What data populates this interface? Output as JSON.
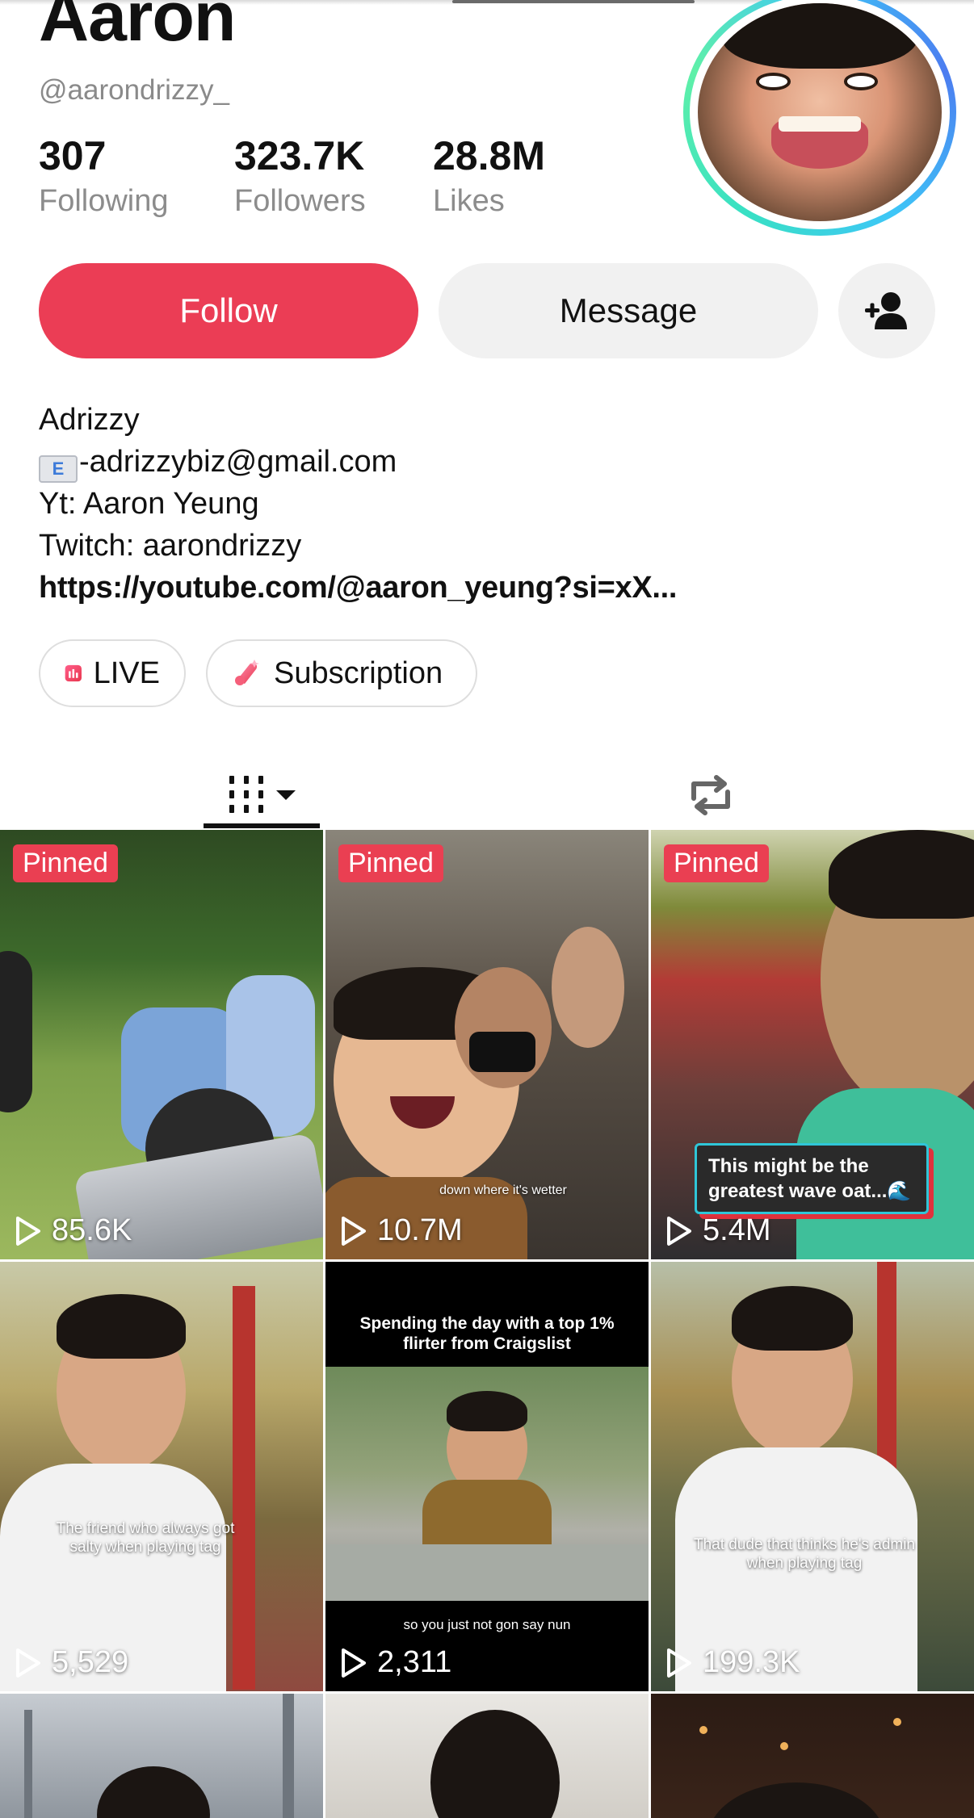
{
  "profile": {
    "name": "Aaron",
    "handle": "@aarondrizzy_",
    "stats": {
      "following": {
        "value": "307",
        "label": "Following"
      },
      "followers": {
        "value": "323.7K",
        "label": "Followers"
      },
      "likes": {
        "value": "28.8M",
        "label": "Likes"
      }
    }
  },
  "actions": {
    "follow_label": "Follow",
    "message_label": "Message",
    "add_friend_icon": "add-user-icon"
  },
  "bio": {
    "line1": "Adrizzy",
    "email_emoji": "E",
    "line2": "-adrizzybiz@gmail.com",
    "line3": "Yt: Aaron Yeung",
    "line4": "Twitch: aarondrizzy",
    "link": "https://youtube.com/@aaron_yeung?si=xX..."
  },
  "pills": {
    "live_label": "LIVE",
    "subscription_label": "Subscription"
  },
  "tabs": {
    "videos_icon": "grid-icon",
    "reposts_icon": "repost-icon"
  },
  "colors": {
    "accent": "#eb3d55",
    "pinned_badge": "#ea3f52"
  },
  "videos": [
    {
      "pinned": "Pinned",
      "views": "85.6K"
    },
    {
      "pinned": "Pinned",
      "views": "10.7M",
      "caption": "down where it's wetter"
    },
    {
      "pinned": "Pinned",
      "views": "5.4M",
      "caption": "This might be the greatest wave oat...🌊"
    },
    {
      "views": "5,529",
      "caption": "The friend who always got salty when playing tag"
    },
    {
      "views": "2,311",
      "caption_top": "Spending the day with a top 1% flirter from Craigslist",
      "caption_bottom": "so you just not gon say nun"
    },
    {
      "views": "199.3K",
      "caption": "That dude that thinks he's admin when playing tag"
    }
  ]
}
